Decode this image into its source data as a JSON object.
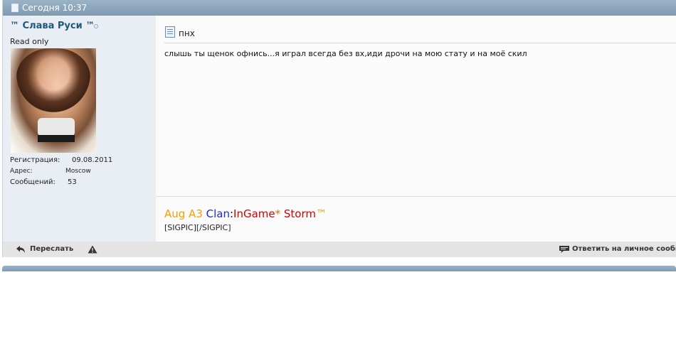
{
  "post": {
    "date": "Сегодня 10:37",
    "user": {
      "name": "™ Слава Руси ™",
      "title": "Read only",
      "details": [
        {
          "label": "Регистрация:",
          "value": "09.08.2011"
        },
        {
          "label": "Адрес:",
          "value": "Moscow"
        },
        {
          "label": "Сообщений:",
          "value": "53"
        }
      ]
    },
    "title": "пнх",
    "message": "слышь ты щенок офнись...я играл всегда без вх,иди дрочи на мою стату и на моё скил",
    "signature": {
      "parts": [
        {
          "text": "Aug A3 ",
          "color": "#f0a000"
        },
        {
          "text": "Clan",
          "color": "#1a2bd0"
        },
        {
          "text": ":",
          "color": "#111111"
        },
        {
          "text": "InGame",
          "color": "#d40000"
        },
        {
          "text": "*",
          "color": "#d07000"
        },
        {
          "text": " Storm",
          "color": "#d40000"
        },
        {
          "text": "™",
          "color": "#f0a000"
        }
      ],
      "code": "[SIGPIC][/SIGPIC]"
    },
    "footer": {
      "forward_label": "Переслать",
      "reply_private_label": "Ответить на личное сообщение"
    }
  },
  "icons": {
    "header_doc": "document-icon",
    "title_doc": "document-icon",
    "forward": "forward-arrow-icon",
    "warn": "warning-icon",
    "reply": "speech-bubble-icon"
  }
}
